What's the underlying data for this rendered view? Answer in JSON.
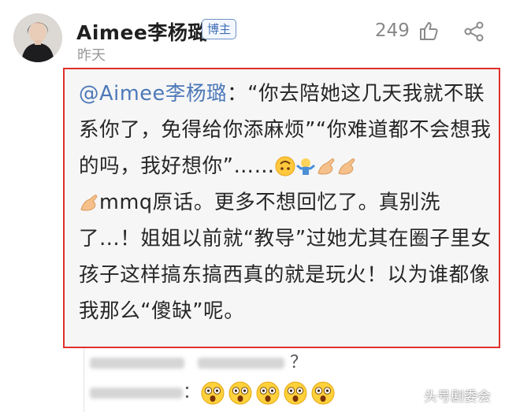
{
  "post": {
    "username": "Aimee李杨璐",
    "badge": "博主",
    "timestamp": "昨天",
    "like_count": "249"
  },
  "quote": {
    "mention": "@Aimee李杨璐",
    "text_1": "：“你去陪她这几天我就不联系你了，免得给你添麻烦”“你难道都不会想我的吗，我好想你”……",
    "text_2": "mmq原话。更多不想回忆了。真别洗了...！姐姐以前就“教导”过她尤其在圈子里女孩子这样搞东搞西真的就是玩火！以为谁都像我那么“傻缺”呢。"
  },
  "replies": {
    "reply_1_partial": "？",
    "reply_2_colon": "："
  },
  "icons": [
    "like-icon",
    "share-icon",
    "upside-down-face-emoji",
    "shrug-emoji",
    "ok-hand-emoji",
    "shocked-face-emoji"
  ],
  "watermark": "头号剧委会",
  "colors": {
    "box_border": "#e0302b",
    "mention": "#4c78b8",
    "badge": "#3f6fb5"
  }
}
